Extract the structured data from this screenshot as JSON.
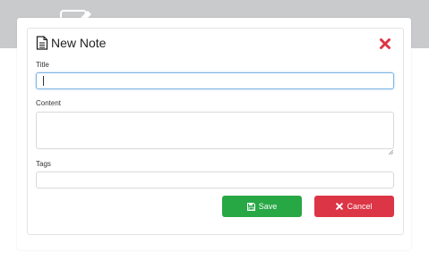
{
  "modal": {
    "title": "New Note",
    "title_icon": "document-icon",
    "close_icon": "close-icon"
  },
  "form": {
    "title_label": "Title",
    "title_value": "",
    "content_label": "Content",
    "content_value": "",
    "tags_label": "Tags",
    "tags_value": ""
  },
  "buttons": {
    "save_label": "Save",
    "save_icon": "floppy-disk-icon",
    "cancel_label": "Cancel",
    "cancel_icon": "x-icon"
  },
  "colors": {
    "topbar": "#c9cacc",
    "save": "#28a745",
    "cancel": "#dc3545",
    "close": "#dc3545",
    "focus_border": "#7fb6e6"
  }
}
